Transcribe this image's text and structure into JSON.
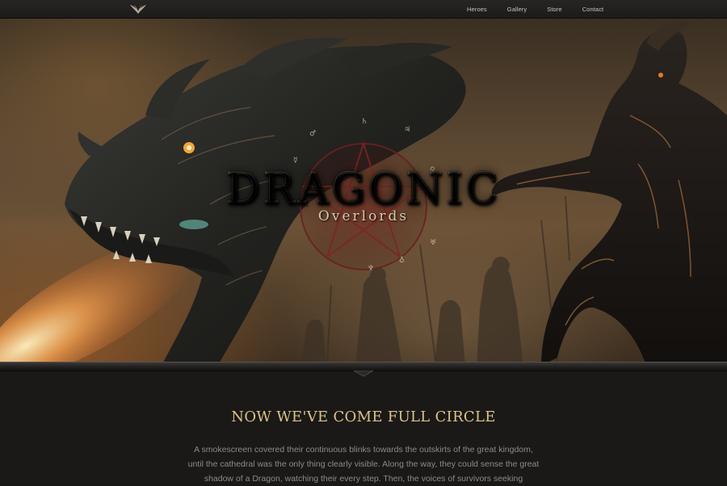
{
  "nav": {
    "logo_icon": "wings-logo-icon",
    "items": [
      {
        "label": "Heroes"
      },
      {
        "label": "Gallery"
      },
      {
        "label": "Store"
      },
      {
        "label": "Contact"
      }
    ]
  },
  "hero": {
    "title": "DRAGONIC",
    "subtitle": "Overlords",
    "artwork": "dragon-and-armored-knight-illustration"
  },
  "content": {
    "heading": "NOW WE'VE COME FULL CIRCLE",
    "body": "A smokescreen covered their continuous blinks towards the outskirts of the great kingdom, until the cathedral was the only thing clearly visible. Along the way, they could sense the great shadow of a Dragon, watching their every step. Then, the voices of survivors seeking"
  },
  "colors": {
    "nav_bg": "#1f1e1d",
    "heading": "#dcc384",
    "body_text": "#8f8a83",
    "page_bg": "#1a1918"
  }
}
